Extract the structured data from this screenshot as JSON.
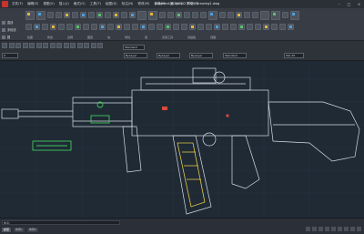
{
  "window": {
    "title": "Autodesk AutoCAD 2021   Drawing1.dwg"
  },
  "menu": [
    "文件(F)",
    "编辑(E)",
    "视图(V)",
    "插入(I)",
    "格式(O)",
    "工具(T)",
    "绘图(D)",
    "标注(N)",
    "修改(M)",
    "参数(P)",
    "窗口(W)",
    "帮助(H)"
  ],
  "ribbon": {
    "panels": [
      "绘图",
      "修改",
      "注释",
      "图层",
      "块",
      "特性",
      "组",
      "实用工具",
      "剪贴板",
      "视图"
    ],
    "left_tools": [
      "直线",
      "多段线",
      "圆"
    ]
  },
  "toolbar": {
    "style_combo": "Standard",
    "layer_combo": "0",
    "linetype_combo": "ByLayer",
    "lineweight_combo": "ByLayer",
    "color_combo": "ByLayer",
    "plot_combo": "Standard",
    "dim_combo": "ISO-25"
  },
  "statusbar": {
    "command_prompt": "命令:",
    "tabs": [
      "模型",
      "布局1",
      "布局2"
    ]
  },
  "colors": {
    "viewport_bg": "#1f2a35",
    "outline": "#d7dde4",
    "highlight_green": "#3fc95a",
    "highlight_yellow": "#e3c64a",
    "highlight_red": "#d84a3a"
  }
}
